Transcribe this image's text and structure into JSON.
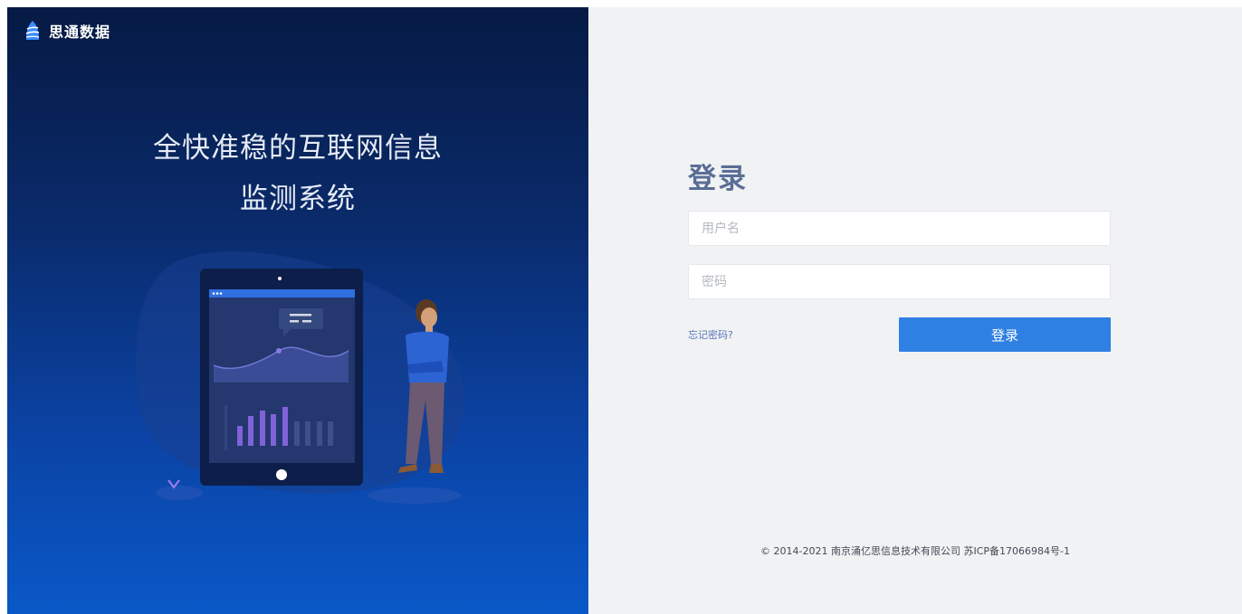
{
  "brand": {
    "name": "思通数据"
  },
  "hero": {
    "line1": "全快准稳的互联网信息",
    "line2": "监测系统"
  },
  "login": {
    "title": "登录",
    "username_placeholder": "用户名",
    "password_placeholder": "密码",
    "forgot_label": "忘记密码?",
    "submit_label": "登录"
  },
  "footer": {
    "copyright": "© 2014-2021 南京涌亿思信息技术有限公司 苏ICP备17066984号-1"
  },
  "colors": {
    "primary": "#2f80e3",
    "title": "#5a6e95",
    "left_bg_top": "#061a44",
    "left_bg_bottom": "#0a58c8",
    "right_bg": "#f1f2f4"
  }
}
